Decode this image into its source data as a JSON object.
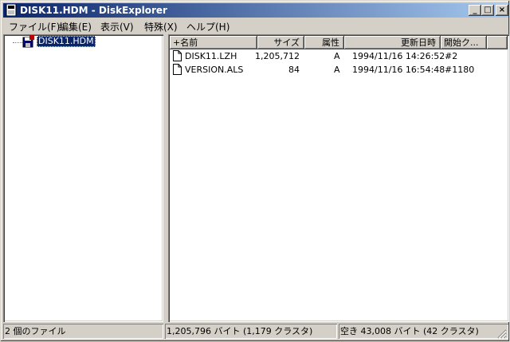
{
  "window": {
    "title": "DISK11.HDM - DiskExplorer"
  },
  "titlebar_buttons": {
    "minimize": "_",
    "maximize": "□",
    "close": "×"
  },
  "menu": [
    "ファイル(F)",
    "編集(E)",
    "表示(V)",
    "特殊(X)",
    "ヘルプ(H)"
  ],
  "tree": {
    "root_label": "DISK11.HDM",
    "root_icon": "disk-image-icon"
  },
  "columns": [
    "+名前",
    "サイズ",
    "属性",
    "更新日時",
    "開始ク..."
  ],
  "files": [
    {
      "name": "DISK11.LZH",
      "size": "1,205,712",
      "attr": "A",
      "date": "1994/11/16 14:26:52",
      "cluster": "#2",
      "icon": "document-icon"
    },
    {
      "name": "VERSION.ALS",
      "size": "84",
      "attr": "A",
      "date": "1994/11/16 16:54:48",
      "cluster": "#1180",
      "icon": "document-icon"
    }
  ],
  "status": {
    "count": "2 個のファイル",
    "bytes": "1,205,796 バイト (1,179 クラスタ)",
    "free": "空き 43,008 バイト (42 クラスタ)"
  },
  "colors": {
    "title_start": "#0a246a",
    "title_end": "#a6caf0",
    "selection": "#0a246a",
    "face": "#d4d0c8"
  }
}
